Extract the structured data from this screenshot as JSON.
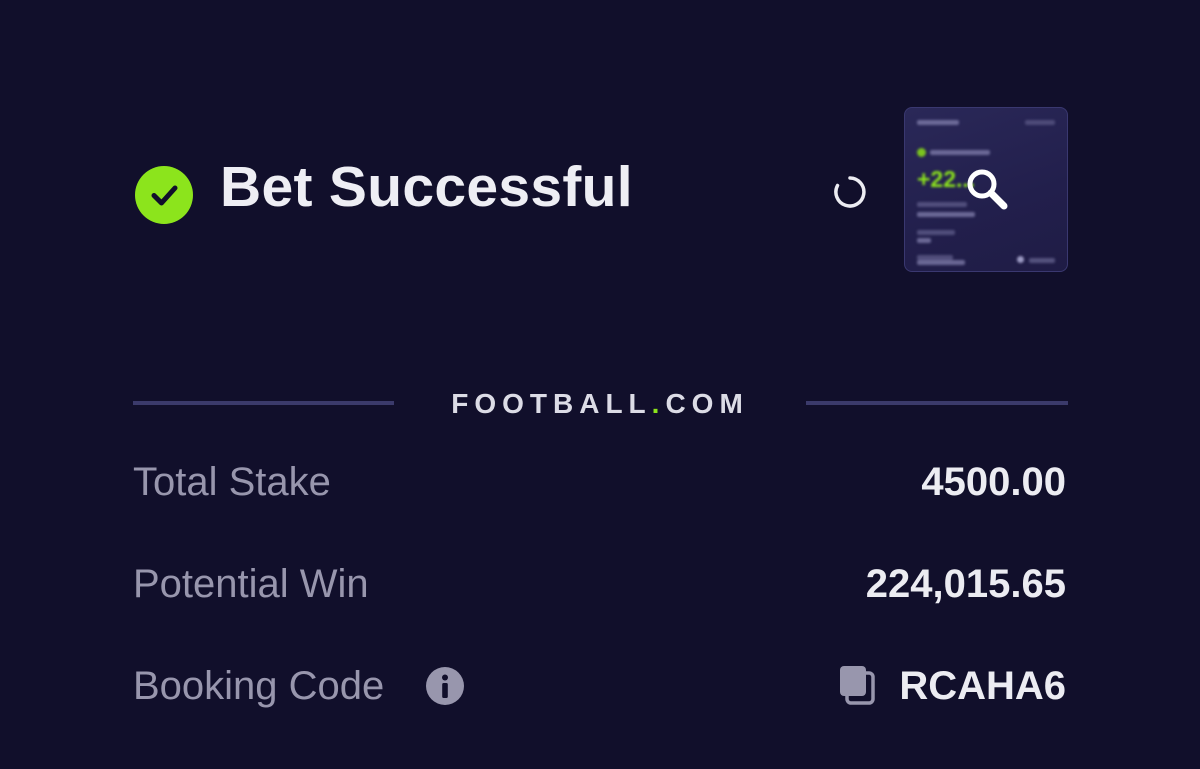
{
  "header": {
    "title": "Bet Successful",
    "status_icon": "check-circle-icon",
    "loading_icon": "spinner-icon",
    "zoom_icon": "magnifier-icon"
  },
  "share_preview": {
    "win_amount_partial": "+22..."
  },
  "brand": {
    "name_part1": "FOOTBALL",
    "dot": ".",
    "name_part2": "COM"
  },
  "summary": {
    "total_stake_label": "Total Stake",
    "total_stake_value": "4500.00",
    "potential_win_label": "Potential Win",
    "potential_win_value": "224,015.65",
    "booking_code_label": "Booking Code",
    "booking_code_value": "RCAHA6"
  },
  "colors": {
    "background": "#110f2b",
    "accent": "#8ce41c",
    "divider": "#3b3a6b",
    "label_text": "#9896ad",
    "value_text": "#ececf2"
  }
}
